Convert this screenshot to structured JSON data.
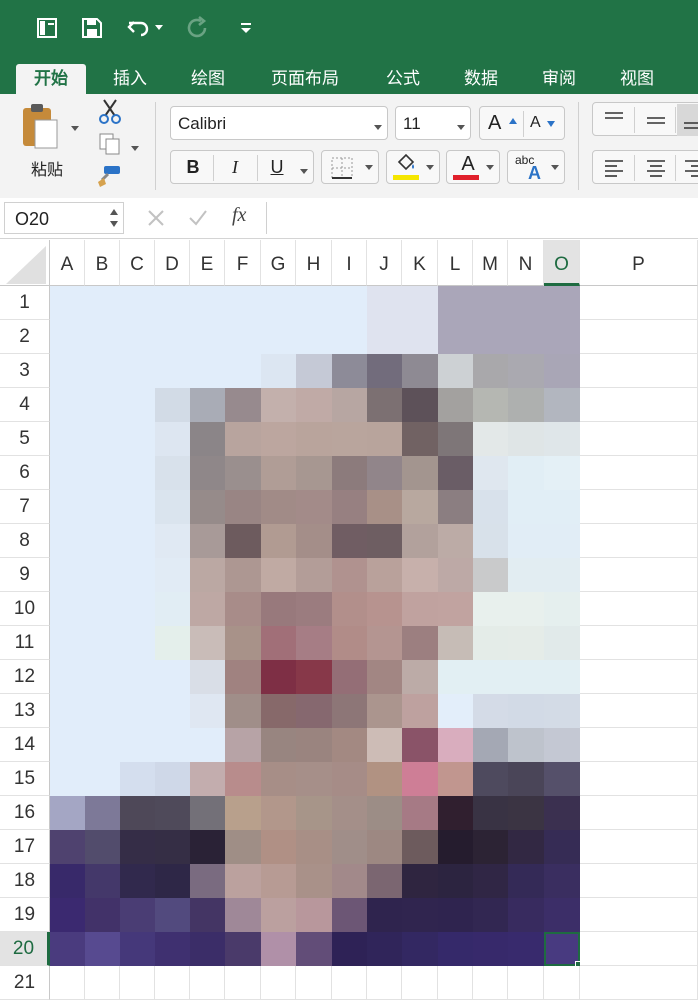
{
  "qat": {
    "icons": [
      "sheet-view-icon",
      "save-icon",
      "undo-icon",
      "undo-dropdown-icon",
      "redo-icon",
      "customize-qat-icon"
    ]
  },
  "tabs": [
    {
      "label": "开始",
      "active": true
    },
    {
      "label": "插入",
      "active": false
    },
    {
      "label": "绘图",
      "active": false
    },
    {
      "label": "页面布局",
      "active": false
    },
    {
      "label": "公式",
      "active": false
    },
    {
      "label": "数据",
      "active": false
    },
    {
      "label": "审阅",
      "active": false
    },
    {
      "label": "视图",
      "active": false
    }
  ],
  "ribbon": {
    "paste_label": "粘贴",
    "font_name": "Calibri",
    "font_size": "11",
    "bold": "B",
    "italic": "I",
    "underline": "U",
    "increase_font": "A",
    "decrease_font": "A",
    "font_color_letter": "A",
    "phonetic_top": "abc",
    "phonetic_bottom": "A",
    "fill_color": "#f5e600",
    "font_color": "#e0202b"
  },
  "formula_bar": {
    "name_box": "O20",
    "fx": "fx",
    "value": ""
  },
  "sheet": {
    "columns": [
      "A",
      "B",
      "C",
      "D",
      "E",
      "F",
      "G",
      "H",
      "I",
      "J",
      "K",
      "L",
      "M",
      "N",
      "O",
      "P"
    ],
    "rows": [
      "1",
      "2",
      "3",
      "4",
      "5",
      "6",
      "7",
      "8",
      "9",
      "10",
      "11",
      "12",
      "13",
      "14",
      "15",
      "16",
      "17",
      "18",
      "19",
      "20",
      "21"
    ],
    "selected_cell": "O20",
    "selected_column": "O",
    "selected_row": "20",
    "fills": [
      [
        "#e1edfa",
        "#e1edfa",
        "#e1edfa",
        "#e1edfa",
        "#e1edfa",
        "#e1edfa",
        "#e1edfa",
        "#e1edfa",
        "#e1edfa",
        "#dfe3ef",
        "#dfe3ef",
        "#aaa6b9",
        "#aaa6b9",
        "#aaa6b9",
        "#aaa6b9"
      ],
      [
        "#e1edfa",
        "#e1edfa",
        "#e1edfa",
        "#e1edfa",
        "#e1edfa",
        "#e1edfa",
        "#e1edfa",
        "#e1edfa",
        "#e1edfa",
        "#dfe3ef",
        "#dfe3ef",
        "#aaa6b9",
        "#aaa6b9",
        "#aaa6b9",
        "#aaa6b9"
      ],
      [
        "#e1edfa",
        "#e1edfa",
        "#e1edfa",
        "#e1edfa",
        "#e1edfa",
        "#e1edfa",
        "#dce6f2",
        "#c5c9d6",
        "#8d8b98",
        "#726c7c",
        "#8e8a93",
        "#cdd1d4",
        "#a9a8ab",
        "#aaa9b0",
        "#a9a6b6"
      ],
      [
        "#e1edfa",
        "#e1edfa",
        "#e1edfa",
        "#d2dbe6",
        "#a9acb6",
        "#978a8e",
        "#c3b0ac",
        "#c0aaa6",
        "#b7a6a2",
        "#7c7072",
        "#5d5159",
        "#a3a19f",
        "#b5b7b2",
        "#aeb0af",
        "#b2b6bf"
      ],
      [
        "#e1edfa",
        "#e1edfa",
        "#e1edfa",
        "#dde6f1",
        "#8b8588",
        "#b8a49e",
        "#bca69f",
        "#b9a49c",
        "#b9a59d",
        "#b8a49c",
        "#716263",
        "#7e7678",
        "#e3e8e8",
        "#dfe5e6",
        "#dfe6e9"
      ],
      [
        "#e1edfa",
        "#e1edfa",
        "#e1edfa",
        "#d8e1eb",
        "#8f8789",
        "#9a8f8e",
        "#b09d96",
        "#a79791",
        "#8c7b7c",
        "#91858a",
        "#a3958f",
        "#6a5d66",
        "#dfe7ef",
        "#e1eef5",
        "#e4f0f6"
      ],
      [
        "#e1edfa",
        "#e1edfa",
        "#e1edfa",
        "#dae4ee",
        "#968b8a",
        "#998584",
        "#a18b87",
        "#a38b89",
        "#978081",
        "#a89087",
        "#b8a89f",
        "#8b7e81",
        "#d8e1eb",
        "#e1eef6",
        "#e1eef6"
      ],
      [
        "#e1edfa",
        "#e1edfa",
        "#e1edfa",
        "#e0e9f3",
        "#a89a98",
        "#6d5b5e",
        "#b19b92",
        "#a48e89",
        "#705d63",
        "#6e5e62",
        "#b2a19c",
        "#bcaba6",
        "#d8e1ea",
        "#e1edf6",
        "#e1edf6"
      ],
      [
        "#e1edfa",
        "#e1edfa",
        "#e1edfa",
        "#e1ebf5",
        "#bba8a3",
        "#ad9792",
        "#c0aaa3",
        "#b39d98",
        "#b0928f",
        "#b9a19b",
        "#c7b0ab",
        "#bda9a6",
        "#c9cacb",
        "#e2edf2",
        "#e2edf2"
      ],
      [
        "#e1edfa",
        "#e1edfa",
        "#e1edfa",
        "#e1edf4",
        "#bea8a4",
        "#a88c89",
        "#98797c",
        "#9b7c7f",
        "#b28f8b",
        "#b7938f",
        "#c0a29f",
        "#c1a3a0",
        "#e8f0ed",
        "#e8f0ed",
        "#e5efee"
      ],
      [
        "#e1edfa",
        "#e1edfa",
        "#e1edfa",
        "#e4efeb",
        "#c9bcb8",
        "#a89289",
        "#a16f78",
        "#a67d85",
        "#b18c88",
        "#b49591",
        "#9c7f80",
        "#c6bcb6",
        "#e4ece8",
        "#e5ece8",
        "#e1eaea"
      ],
      [
        "#e1edfa",
        "#e1edfa",
        "#e1edfa",
        "#e1edfa",
        "#d9dee7",
        "#a08280",
        "#7e2f45",
        "#873849",
        "#946e76",
        "#a28683",
        "#bcaba7",
        "#e2eff3",
        "#e2eff3",
        "#e2eff3",
        "#e2eff3"
      ],
      [
        "#e1edfa",
        "#e1edfa",
        "#e1edfa",
        "#e1edfa",
        "#dfe7f2",
        "#a08e89",
        "#87696a",
        "#86686f",
        "#8d7677",
        "#ab958e",
        "#bea19f",
        "#e3eefa",
        "#d4dbe7",
        "#d2dae6",
        "#d3dbe6"
      ],
      [
        "#e1edfa",
        "#e1edfa",
        "#e1edfa",
        "#e1edfa",
        "#e1edfa",
        "#b7a3a6",
        "#988580",
        "#9a847f",
        "#a38982",
        "#cdbcb6",
        "#8a5368",
        "#d9adbe",
        "#a4a8b4",
        "#bec3cc",
        "#c4c8d3"
      ],
      [
        "#e1edfa",
        "#e1edfa",
        "#d4deee",
        "#cfd8e8",
        "#c3adae",
        "#b88c8c",
        "#a78e87",
        "#a68f89",
        "#a68c87",
        "#b19282",
        "#ce7e96",
        "#c1968f",
        "#4e4a5e",
        "#4a4558",
        "#55506a"
      ],
      [
        "#a4a6c4",
        "#7d7998",
        "#4e4858",
        "#4f4a5a",
        "#737078",
        "#b8a08c",
        "#b2978b",
        "#a79589",
        "#a48f89",
        "#9c8d86",
        "#a67a85",
        "#301f2f",
        "#393344",
        "#3b3443",
        "#3b3050"
      ],
      [
        "#4f426f",
        "#524c6c",
        "#352d47",
        "#352e45",
        "#2a2236",
        "#9f8e86",
        "#b09085",
        "#a88f86",
        "#a08e89",
        "#9d8882",
        "#6d5b5d",
        "#251c2e",
        "#2c2334",
        "#322843",
        "#362c55"
      ],
      [
        "#38296a",
        "#44386a",
        "#31294d",
        "#2e2747",
        "#7a6b80",
        "#bba19e",
        "#b79b94",
        "#a99189",
        "#a2898a",
        "#7b6671",
        "#2f2540",
        "#2c2440",
        "#302645",
        "#342a57",
        "#3a2e60"
      ],
      [
        "#3b2970",
        "#423269",
        "#4a3d74",
        "#524a7e",
        "#443564",
        "#9f8898",
        "#bba09f",
        "#b8979c",
        "#6c5675",
        "#2f244e",
        "#30254f",
        "#2f244f",
        "#322752",
        "#382b5f",
        "#3c2e68"
      ],
      [
        "#4a3b7e",
        "#574a90",
        "#45387a",
        "#3f3070",
        "#3b2d68",
        "#4a3a6a",
        "#b090a8",
        "#624d78",
        "#2e2256",
        "#30255a",
        "#332862",
        "#35296a",
        "#37296b",
        "#382a6d",
        "#483a80"
      ],
      [
        "#ffffff",
        "#ffffff",
        "#ffffff",
        "#ffffff",
        "#ffffff",
        "#ffffff",
        "#ffffff",
        "#ffffff",
        "#ffffff",
        "#ffffff",
        "#ffffff",
        "#ffffff",
        "#ffffff",
        "#ffffff",
        "#ffffff",
        "#ffffff"
      ]
    ]
  }
}
